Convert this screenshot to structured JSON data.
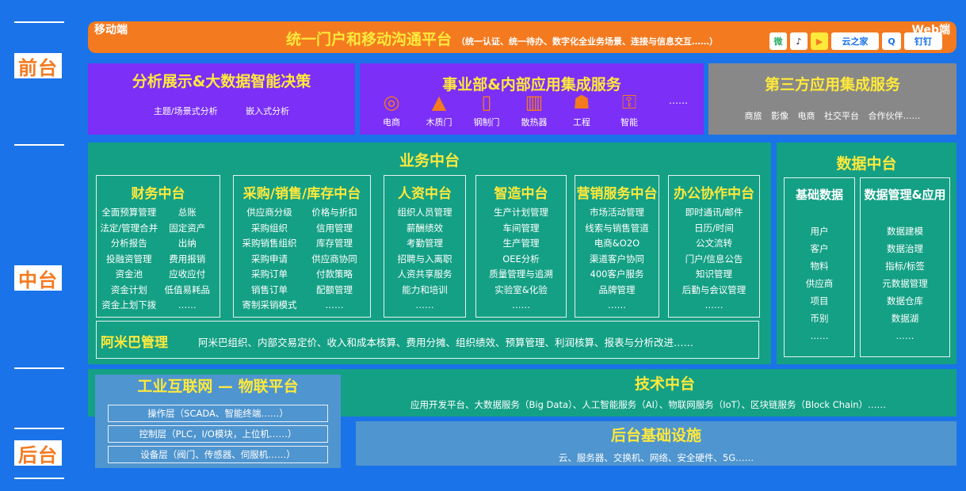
{
  "side_labels": {
    "front": "前台",
    "middle": "中台",
    "back": "后台"
  },
  "portal": {
    "mobile_label": "移动端",
    "web_label": "Web端",
    "title": "统一门户和移动沟通平台",
    "subtitle": "（统一认证、统一待办、数字化全业务场景、连接与信息交互……）",
    "apps": [
      {
        "icon": "wechat-icon",
        "label": "微"
      },
      {
        "icon": "tiktok-icon",
        "label": "♪"
      },
      {
        "icon": "kuaishou-icon",
        "label": "▶"
      },
      {
        "icon": "yunzhijia-icon",
        "label": "云之家"
      },
      {
        "icon": "qq-icon",
        "label": "Q"
      },
      {
        "icon": "dingtalk-icon",
        "label": "钉钉"
      }
    ]
  },
  "front": {
    "analytics": {
      "title": "分析展示&大数据智能决策",
      "items": [
        "主题/场景式分析",
        "嵌入式分析"
      ]
    },
    "business_units": {
      "title": "事业部&内部应用集成服务",
      "items": [
        {
          "icon": "ecommerce-icon",
          "label": "电商"
        },
        {
          "icon": "wooden-door-icon",
          "label": "木质门"
        },
        {
          "icon": "steel-door-icon",
          "label": "钢制门"
        },
        {
          "icon": "radiator-icon",
          "label": "散热器"
        },
        {
          "icon": "engineering-icon",
          "label": "工程"
        },
        {
          "icon": "smart-lock-icon",
          "label": "智能"
        }
      ],
      "more": "……"
    },
    "third_party": {
      "title": "第三方应用集成服务",
      "items": [
        "商旅",
        "影像",
        "电商",
        "社交平台",
        "合作伙伴……"
      ]
    }
  },
  "business_middle": {
    "title": "业务中台",
    "modules": [
      {
        "title": "财务中台",
        "items": [
          "全面预算管理",
          "总账",
          "法定/管理合并",
          "固定资产",
          "分析报告",
          "出纳",
          "投融资管理",
          "费用报销",
          "资金池",
          "应收应付",
          "资金计划",
          "低值易耗品",
          "资金上划下拨",
          "……"
        ]
      },
      {
        "title": "采购/销售/库存中台",
        "items": [
          "供应商分级",
          "价格与折扣",
          "采购组织",
          "信用管理",
          "采购销售组织",
          "库存管理",
          "采购申请",
          "供应商协同",
          "采购订单",
          "付款策略",
          "销售订单",
          "配额管理",
          "寄制采销模式",
          "……"
        ]
      },
      {
        "title": "人资中台",
        "items": [
          "组织人员管理",
          "薪酬绩效",
          "考勤管理",
          "招聘与入离职",
          "人资共享服务",
          "能力和培训",
          "……"
        ]
      },
      {
        "title": "智造中台",
        "items": [
          "生产计划管理",
          "车间管理",
          "生产管理",
          "OEE分析",
          "质量管理与追溯",
          "实验室&化验",
          "……"
        ]
      },
      {
        "title": "营销服务中台",
        "items": [
          "市场活动管理",
          "线索与销售管道",
          "电商&O2O",
          "渠道客户协同",
          "400客户服务",
          "品牌管理",
          "……"
        ]
      },
      {
        "title": "办公协作中台",
        "items": [
          "即时通讯/邮件",
          "日历/时间",
          "公文流转",
          "门户/信息公告",
          "知识管理",
          "后勤与会议管理",
          "……"
        ]
      }
    ],
    "amoeba": {
      "title": "阿米巴管理",
      "desc": "阿米巴组织、内部交易定价、收入和成本核算、费用分摊、组织绩效、预算管理、利润核算、报表与分析改进……"
    }
  },
  "data_middle": {
    "title": "数据中台",
    "basic": {
      "title": "基础数据",
      "items": [
        "用户",
        "客户",
        "物料",
        "供应商",
        "项目",
        "币别",
        "……"
      ]
    },
    "management": {
      "title": "数据管理&应用",
      "items": [
        "数据建模",
        "数据治理",
        "指标/标签",
        "元数据管理",
        "数据仓库",
        "数据湖",
        "……"
      ]
    }
  },
  "tech_middle": {
    "title": "技术中台",
    "desc": "应用开发平台、大数据服务（Big Data）、人工智能服务（AI）、物联网服务（IoT）、区块链服务（Block Chain）……"
  },
  "iot_platform": {
    "title": "工业互联网 — 物联平台",
    "layers": [
      "操作层（SCADA、智能终端……）",
      "控制层（PLC，I/O模块，上位机……）",
      "设备层（阀门、传感器、伺服机……）"
    ]
  },
  "infrastructure": {
    "title": "后台基础设施",
    "desc": "云、服务器、交换机、网络、安全硬件、5G……"
  }
}
